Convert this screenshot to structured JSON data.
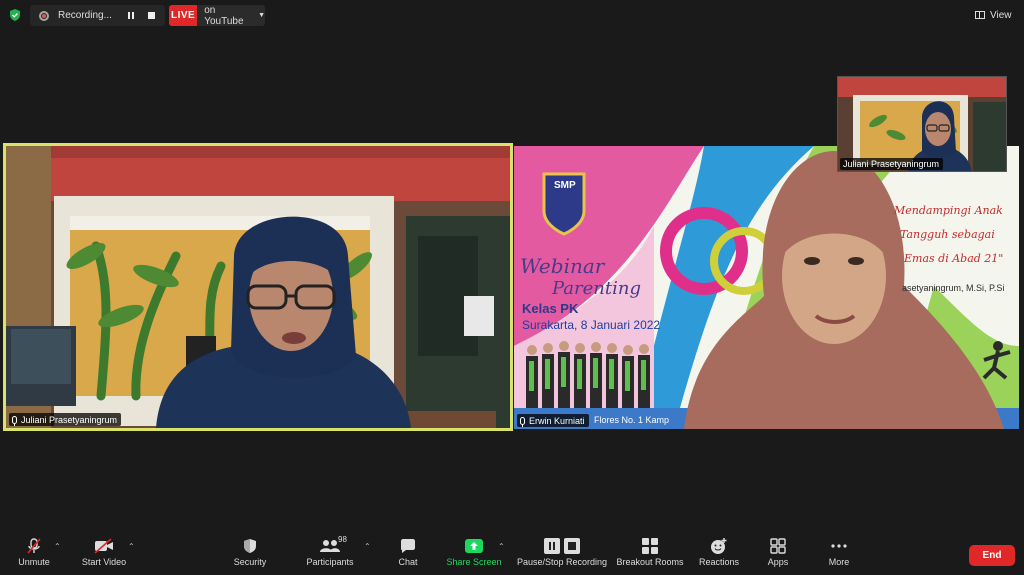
{
  "recording": {
    "label": "Recording..."
  },
  "live": {
    "badge": "LIVE",
    "label": "on YouTube"
  },
  "view": {
    "label": "View"
  },
  "participants": {
    "main": {
      "name": "Juliani Prasetyaningrum"
    },
    "share": {
      "name": "Erwin Kurniati"
    },
    "self": {
      "name": "Juliani Prasetyaningrum"
    }
  },
  "slide": {
    "logo": "SMP",
    "title1": "Webinar",
    "title2": "Parenting",
    "subtitle": "Kelas PK",
    "date": "Surakarta, 8 Januari 2022",
    "tagline1": "Mendampingi Anak",
    "tagline2": "Tangguh sebagai",
    "tagline3": "Emas di Abad 21\"",
    "speaker": "asetyaningrum, M.Si, P.Si",
    "address": "Flores No. 1 Kamp"
  },
  "toolbar": {
    "unmute": "Unmute",
    "start_video": "Start Video",
    "security": "Security",
    "participants": "Participants",
    "participant_count": "98",
    "chat": "Chat",
    "share_screen": "Share Screen",
    "recording": "Pause/Stop Recording",
    "breakout": "Breakout Rooms",
    "reactions": "Reactions",
    "apps": "Apps",
    "more": "More",
    "end": "End"
  },
  "colors": {
    "accent_live": "#e02828",
    "share_green": "#1ed760",
    "active_border": "#d9e36a"
  }
}
